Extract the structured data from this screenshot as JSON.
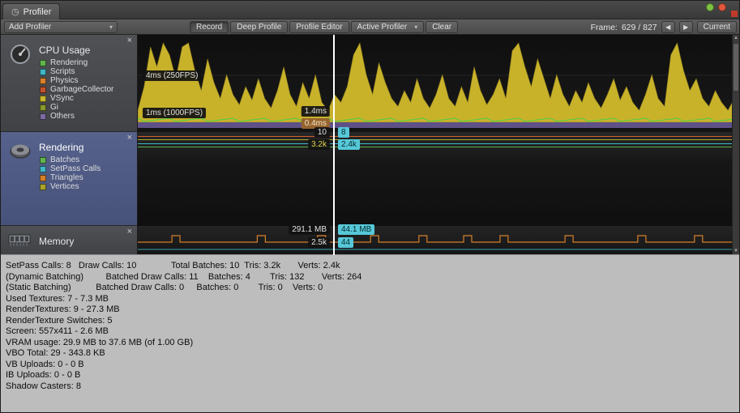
{
  "window": {
    "title": "Profiler"
  },
  "toolbar": {
    "add_profiler": "Add Profiler",
    "record": "Record",
    "deep_profile": "Deep Profile",
    "profile_editor": "Profile Editor",
    "active_profiler": "Active Profiler",
    "clear": "Clear",
    "frame_label": "Frame:",
    "frame_value": "629 / 827",
    "prev_icon": "◀",
    "next_icon": "▶",
    "current": "Current"
  },
  "colors": {
    "badge_cyan": "#56c8d8",
    "selected_card_top": "#56628c",
    "selected_card_bottom": "#46527a",
    "cpu_fill": "#c8b22a",
    "playhead": "#ffffff",
    "win_green": "#7fc243",
    "win_red": "#e0573c",
    "record_square": "#c03a2b"
  },
  "modules": [
    {
      "id": "cpu",
      "title": "CPU Usage",
      "selected": false,
      "legend": [
        {
          "label": "Rendering",
          "color": "#60b44c"
        },
        {
          "label": "Scripts",
          "color": "#41b8c8"
        },
        {
          "label": "Physics",
          "color": "#d6802b"
        },
        {
          "label": "GarbageCollector",
          "color": "#c0512e"
        },
        {
          "label": "VSync",
          "color": "#c8b82e"
        },
        {
          "label": "Gi",
          "color": "#8a9a2e"
        },
        {
          "label": "Others",
          "color": "#7b6ba0"
        }
      ]
    },
    {
      "id": "rendering",
      "title": "Rendering",
      "selected": true,
      "legend": [
        {
          "label": "Batches",
          "color": "#60b44c"
        },
        {
          "label": "SetPass Calls",
          "color": "#41b8c8"
        },
        {
          "label": "Triangles",
          "color": "#d6802b"
        },
        {
          "label": "Vertices",
          "color": "#a8a22e"
        }
      ]
    },
    {
      "id": "memory",
      "title": "Memory",
      "selected": false,
      "legend": []
    }
  ],
  "cpu_chart": {
    "label_top": "4ms (250FPS)",
    "label_bottom": "1ms (1000FPS)",
    "selected_time": "1.4ms",
    "selected_other": "0.4ms",
    "values": [
      15,
      45,
      95,
      70,
      100,
      85,
      55,
      95,
      100,
      65,
      40,
      80,
      50,
      30,
      60,
      35,
      22,
      45,
      28,
      55,
      30,
      18,
      40,
      70,
      35,
      20,
      50,
      30,
      60,
      25,
      15,
      35,
      25,
      45,
      85,
      100,
      60,
      35,
      75,
      50,
      30,
      20,
      40,
      25,
      55,
      30,
      18,
      35,
      60,
      30,
      20,
      45,
      25,
      70,
      40,
      22,
      35,
      55,
      30,
      90,
      100,
      70,
      45,
      80,
      55,
      30,
      60,
      35,
      20,
      40,
      25,
      50,
      30,
      18,
      35,
      55,
      28,
      45,
      25,
      15,
      35,
      60,
      30,
      20,
      85,
      100,
      65,
      40,
      55,
      30,
      20,
      40,
      25,
      15,
      30
    ]
  },
  "rendering_chart": {
    "badges": {
      "left_top": "10",
      "right_top": "8",
      "left_bottom": "3.2k",
      "right_bottom": "2.4k"
    },
    "lines": [
      {
        "name": "Triangles",
        "color": "#d0622e",
        "y": 5
      },
      {
        "name": "Vertices",
        "color": "#b0a82e",
        "y": 9
      },
      {
        "name": "SetPass Calls",
        "color": "#41b8c8",
        "y": 14
      },
      {
        "name": "Batches",
        "color": "#60b44c",
        "y": 18
      }
    ]
  },
  "memory_chart": {
    "badges": {
      "left_top": "291.1 MB",
      "right_top": "44.1 MB",
      "left_bottom": "2.5k",
      "right_bottom": "44"
    },
    "line_color": "#d6802b",
    "secondary_color": "#41b8c8",
    "bumps": [
      0.064,
      0.207,
      0.308,
      0.397,
      0.478,
      0.553,
      0.614,
      0.723,
      0.845,
      0.94
    ]
  },
  "stats": {
    "lines": [
      "SetPass Calls: 8   Draw Calls: 10              Total Batches: 10  Tris: 3.2k       Verts: 2.4k",
      "(Dynamic Batching)         Batched Draw Calls: 11    Batches: 4        Tris: 132       Verts: 264",
      "(Static Batching)          Batched Draw Calls: 0     Batches: 0        Tris: 0    Verts: 0",
      "Used Textures: 7 - 7.3 MB",
      "RenderTextures: 9 - 27.3 MB",
      "RenderTexture Switches: 5",
      "Screen: 557x411 - 2.6 MB",
      "VRAM usage: 29.9 MB to 37.6 MB (of 1.00 GB)",
      "VBO Total: 29 - 343.8 KB",
      "VB Uploads: 0 - 0 B",
      "IB Uploads: 0 - 0 B",
      "Shadow Casters: 8"
    ]
  }
}
